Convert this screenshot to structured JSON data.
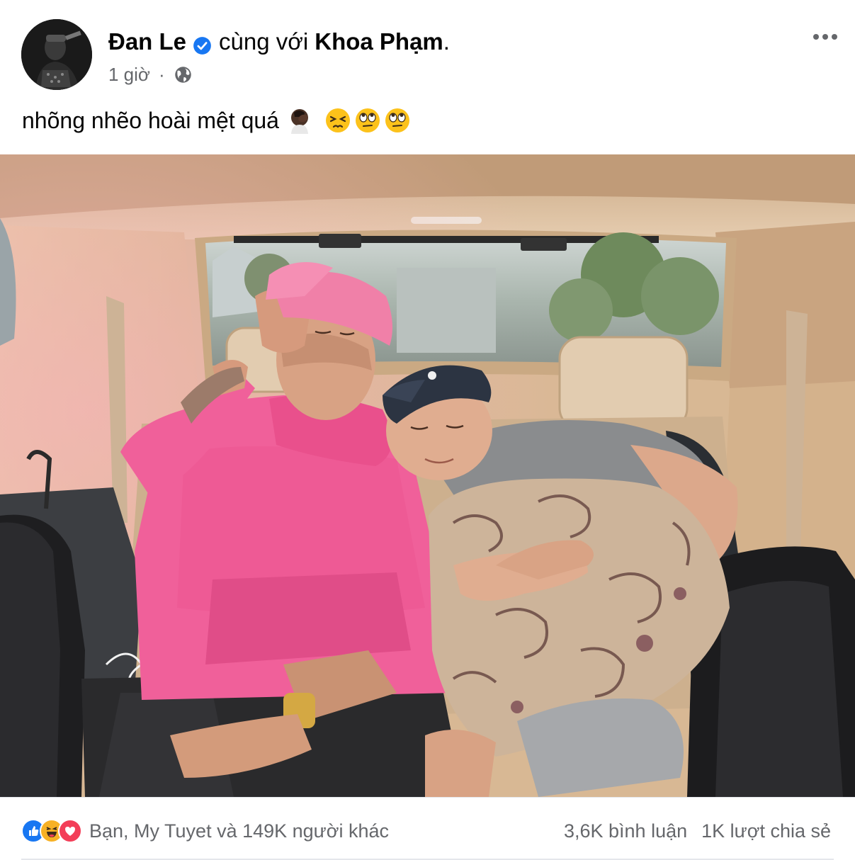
{
  "post": {
    "author": "Đan Le",
    "with_text": "cùng với",
    "tagged": "Khoa Phạm",
    "tagged_suffix": ".",
    "time": "1 giờ",
    "separator": "·",
    "privacy_icon": "globe-icon",
    "more_icon": "more-horizontal-icon",
    "caption": "nhõng nhẽo hoài mệt quá",
    "caption_emojis": [
      "facepalm-emoji",
      "persevering-face-emoji",
      "eye-roll-emoji",
      "eye-roll-emoji"
    ]
  },
  "footer": {
    "reactions_text": "Bạn, My Tuyet và 149K người khác",
    "reaction_icons": [
      "like-icon",
      "haha-icon",
      "love-icon"
    ],
    "comments": "3,6K bình luận",
    "shares": "1K lượt chia sẻ"
  },
  "colors": {
    "verified": "#1877f2",
    "like": "#1877f2",
    "love": "#f33e58",
    "haha": "#f7b125",
    "muted_text": "#65676b",
    "hoodie_pink": "#f0609a",
    "cap_pink": "#f080a8",
    "car_interior": "#d8b894"
  }
}
